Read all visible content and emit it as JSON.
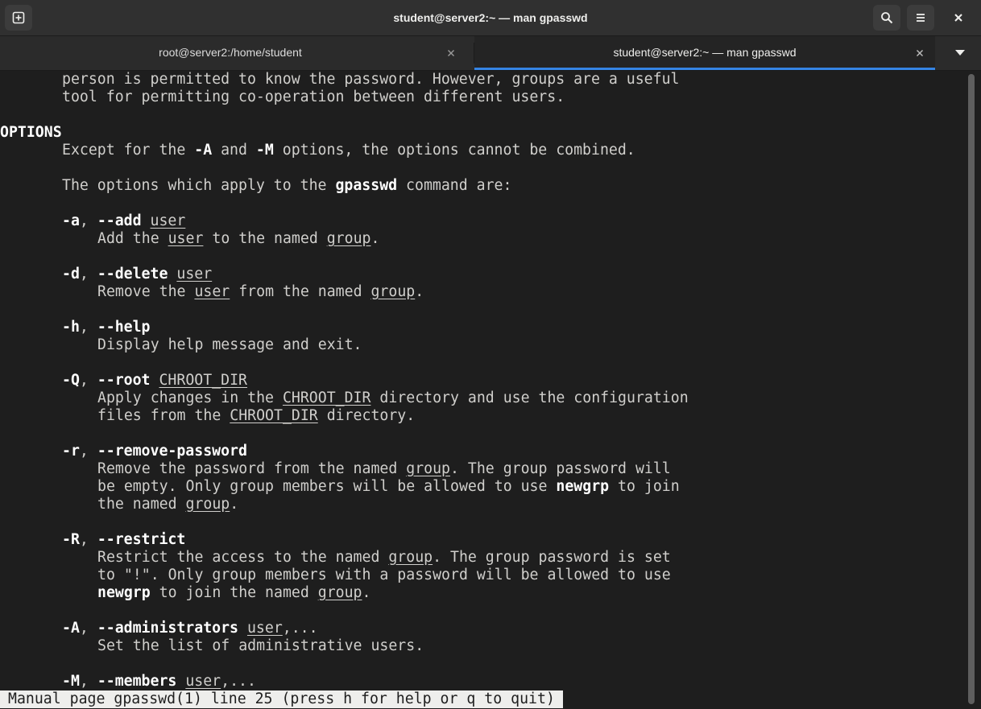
{
  "window": {
    "title": "student@server2:~ — man gpasswd"
  },
  "header": {
    "new_tab_icon": "new-tab-icon",
    "search_icon": "search-icon",
    "menu_icon": "hamburger-menu-icon",
    "close_icon": "close-icon"
  },
  "tabs": [
    {
      "label": "root@server2:/home/student",
      "active": false
    },
    {
      "label": "student@server2:~ — man gpasswd",
      "active": true
    }
  ],
  "colors": {
    "accent": "#3584e4",
    "background": "#1e1e1e",
    "text": "#d0cfcc",
    "bold_text": "#ffffff"
  },
  "terminal": {
    "l1": "person is permitted to know the password. However, groups are a useful",
    "l2": "tool for permitting co-operation between different users.",
    "l3": "OPTIONS",
    "l4a": "Except for the ",
    "l4b": "-A",
    "l4c": " and ",
    "l4d": "-M",
    "l4e": " options, the options cannot be combined.",
    "l5a": "The options which apply to the ",
    "l5b": "gpasswd",
    "l5c": " command are:",
    "o1a": "-a",
    "o1b": ", ",
    "o1c": "--add",
    "o1d": " ",
    "o1e": "user",
    "o1f": "Add the ",
    "o1g": "user",
    "o1h": " to the named ",
    "o1i": "group",
    "o1j": ".",
    "o2a": "-d",
    "o2b": ", ",
    "o2c": "--delete",
    "o2d": " ",
    "o2e": "user",
    "o2f": "Remove the ",
    "o2g": "user",
    "o2h": " from the named ",
    "o2i": "group",
    "o2j": ".",
    "o3a": "-h",
    "o3b": ", ",
    "o3c": "--help",
    "o3d": "Display help message and exit.",
    "o4a": "-Q",
    "o4b": ", ",
    "o4c": "--root",
    "o4d": " ",
    "o4e": "CHROOT_DIR",
    "o4f": "Apply changes in the ",
    "o4g": "CHROOT_DIR",
    "o4h": " directory and use the configuration",
    "o4i": "files from the ",
    "o4j": "CHROOT_DIR",
    "o4k": " directory.",
    "o5a": "-r",
    "o5b": ", ",
    "o5c": "--remove-password",
    "o5d": "Remove the password from the named ",
    "o5e": "group",
    "o5f": ". The group password will",
    "o5g": "be empty. Only group members will be allowed to use ",
    "o5h": "newgrp",
    "o5i": " to join",
    "o5j": "the named ",
    "o5k": "group",
    "o5l": ".",
    "o6a": "-R",
    "o6b": ", ",
    "o6c": "--restrict",
    "o6d": "Restrict the access to the named ",
    "o6e": "group",
    "o6f": ". The group password is set",
    "o6g": "to \"!\". Only group members with a password will be allowed to use",
    "o6h": "newgrp",
    "o6i": " to join the named ",
    "o6j": "group",
    "o6k": ".",
    "o7a": "-A",
    "o7b": ", ",
    "o7c": "--administrators",
    "o7d": " ",
    "o7e": "user",
    "o7f": ",...",
    "o7g": "Set the list of administrative users.",
    "o8a": "-M",
    "o8b": ", ",
    "o8c": "--members",
    "o8d": " ",
    "o8e": "user",
    "o8f": ",..."
  },
  "status": "Manual page gpasswd(1) line 25 (press h for help or q to quit)"
}
